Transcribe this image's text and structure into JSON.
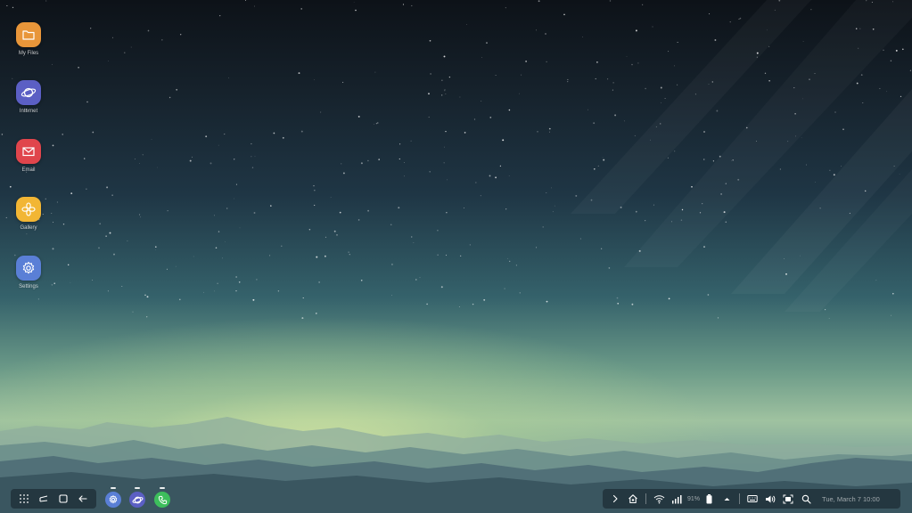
{
  "desktop": {
    "shortcuts": [
      {
        "label": "My Files",
        "icon": "folder-icon",
        "color": "#e8963a"
      },
      {
        "label": "Internet",
        "icon": "planet-icon",
        "color": "#5b5fc4"
      },
      {
        "label": "Email",
        "icon": "envelope-icon",
        "color": "#e0454c"
      },
      {
        "label": "Gallery",
        "icon": "flower-icon",
        "color": "#f2b634"
      },
      {
        "label": "Settings",
        "icon": "gear-icon",
        "color": "#5a7fd6"
      }
    ]
  },
  "taskbar": {
    "nav_buttons": [
      {
        "icon": "app-grid-icon"
      },
      {
        "icon": "recent-apps-icon"
      },
      {
        "icon": "home-icon"
      },
      {
        "icon": "back-arrow-icon"
      }
    ],
    "running_apps": [
      {
        "icon": "gear-icon",
        "color": "#5a7fd6"
      },
      {
        "icon": "planet-icon",
        "color": "#5b5fc4"
      },
      {
        "icon": "phone-icon",
        "color": "#3dbe5c"
      }
    ],
    "tray": {
      "battery_percent": "91%",
      "clock": "Tue, March 7 10:00"
    }
  }
}
